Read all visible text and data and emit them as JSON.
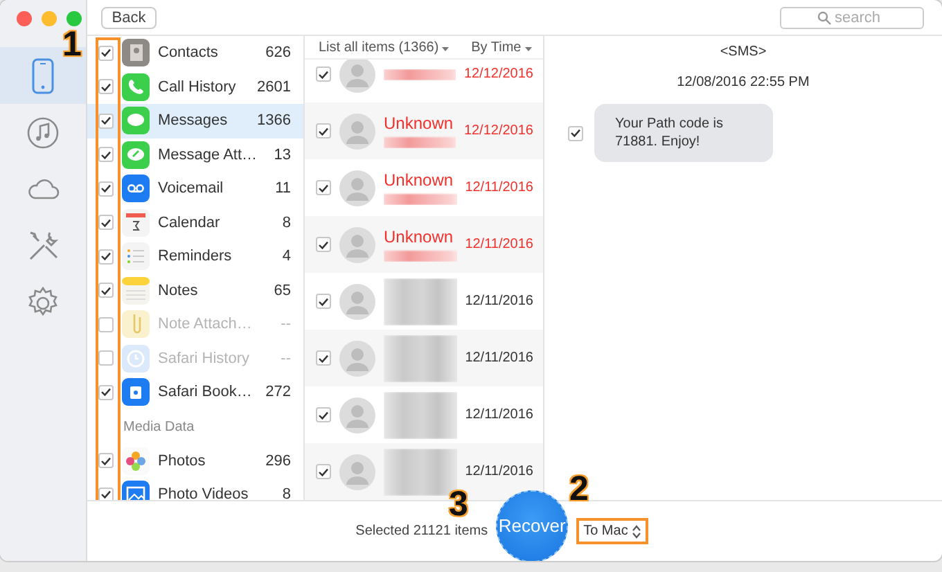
{
  "toolbar": {
    "back_button": "Back",
    "search": {
      "placeholder": "search"
    }
  },
  "rail": [
    {
      "kind": "phone",
      "selected": true
    },
    {
      "kind": "music",
      "selected": false
    },
    {
      "kind": "cloud",
      "selected": false
    },
    {
      "kind": "tools",
      "selected": false
    },
    {
      "kind": "gear",
      "selected": false
    }
  ],
  "categories": {
    "callout": "1",
    "sections": [
      {
        "items": [
          {
            "kind": "contacts",
            "name": "Contacts",
            "count": "626",
            "checked": true,
            "disabled": false,
            "selected": false
          },
          {
            "kind": "phone",
            "name": "Call History",
            "count": "2601",
            "checked": true,
            "disabled": false,
            "selected": false
          },
          {
            "kind": "messages",
            "name": "Messages",
            "count": "1366",
            "checked": true,
            "disabled": false,
            "selected": true
          },
          {
            "kind": "attachments",
            "name": "Message Att…",
            "count": "13",
            "checked": true,
            "disabled": false,
            "selected": false
          },
          {
            "kind": "voicemail",
            "name": "Voicemail",
            "count": "11",
            "checked": true,
            "disabled": false,
            "selected": false
          },
          {
            "kind": "calendar",
            "name": "Calendar",
            "count": "8",
            "checked": true,
            "disabled": false,
            "selected": false
          },
          {
            "kind": "reminders",
            "name": "Reminders",
            "count": "4",
            "checked": true,
            "disabled": false,
            "selected": false
          },
          {
            "kind": "notes",
            "name": "Notes",
            "count": "65",
            "checked": true,
            "disabled": false,
            "selected": false
          },
          {
            "kind": "note-attach",
            "name": "Note Attach…",
            "count": "--",
            "checked": false,
            "disabled": true,
            "selected": false
          },
          {
            "kind": "safari-history",
            "name": "Safari History",
            "count": "--",
            "checked": false,
            "disabled": true,
            "selected": false
          },
          {
            "kind": "safari-bookmarks",
            "name": "Safari Book…",
            "count": "272",
            "checked": true,
            "disabled": false,
            "selected": false
          }
        ]
      },
      {
        "title": "Media Data",
        "items": [
          {
            "kind": "photos",
            "name": "Photos",
            "count": "296",
            "checked": true,
            "disabled": false,
            "selected": false
          },
          {
            "kind": "photo-videos",
            "name": "Photo Videos",
            "count": "8",
            "checked": true,
            "disabled": false,
            "selected": false
          }
        ]
      }
    ]
  },
  "message_list": {
    "filter": "List all items (1366)",
    "sort": "By Time",
    "rows": [
      {
        "kind": "deleted",
        "date": "12/12/2016",
        "checked": true
      },
      {
        "kind": "deleted",
        "name": "Unknown",
        "date": "12/12/2016",
        "checked": true
      },
      {
        "kind": "deleted",
        "name": "Unknown",
        "date": "12/11/2016",
        "checked": true
      },
      {
        "kind": "deleted",
        "name": "Unknown",
        "date": "12/11/2016",
        "checked": true
      },
      {
        "kind": "existing",
        "date": "12/11/2016",
        "checked": true
      },
      {
        "kind": "existing",
        "date": "12/11/2016",
        "checked": true
      },
      {
        "kind": "existing",
        "date": "12/11/2016",
        "checked": true
      },
      {
        "kind": "existing",
        "date": "12/11/2016",
        "checked": true
      }
    ]
  },
  "detail": {
    "title": "<SMS>",
    "timestamp": "12/08/2016 22:55 PM",
    "message": {
      "text": "Your Path code is 71881. Enjoy!",
      "checked": true
    }
  },
  "footer": {
    "selected_text": "Selected 21121 items",
    "recover_button": "Recover",
    "recover_callout": "3",
    "destination": "To Mac",
    "destination_callout": "2"
  }
}
